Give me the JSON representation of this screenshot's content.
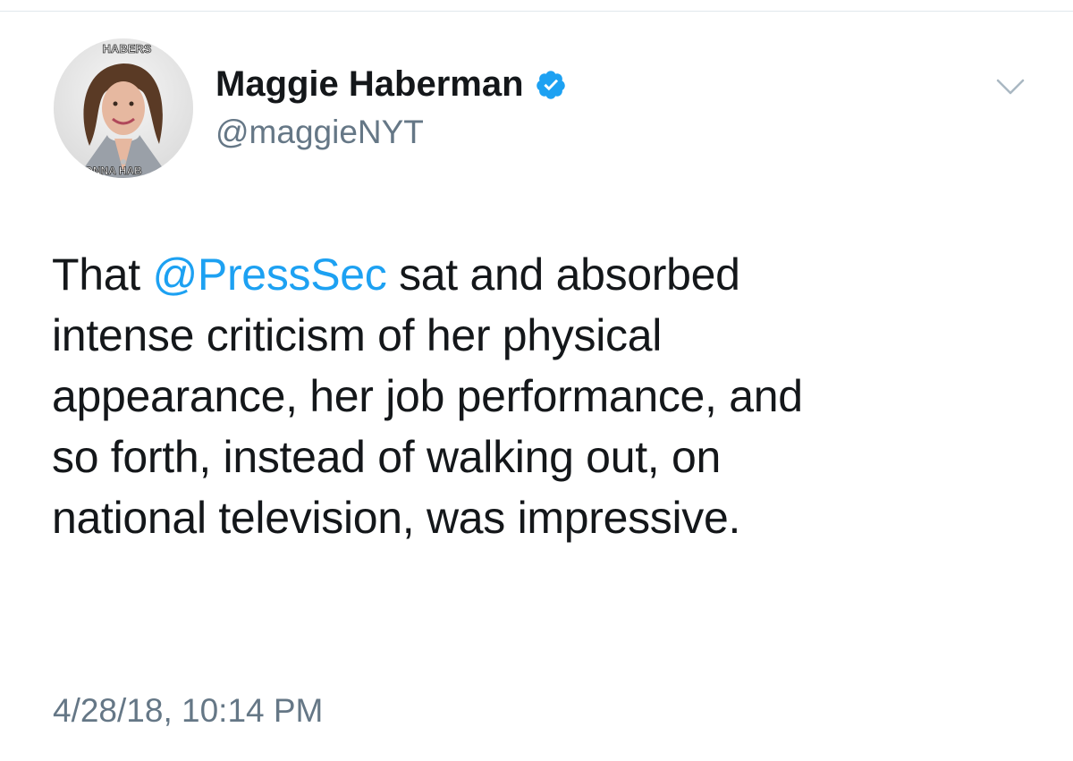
{
  "author": {
    "display_name": "Maggie Haberman",
    "handle": "@maggieNYT",
    "verified": true,
    "avatar_caption_top": "HABERS",
    "avatar_caption_bottom": "GONNA HAB"
  },
  "tweet": {
    "line1_prefix": "That ",
    "mention": "@PressSec",
    "line1_suffix": " sat and absorbed",
    "line2": "intense criticism of her physical",
    "line3": "appearance, her job performance, and",
    "line4": "so forth, instead of walking out, on",
    "line5": "national television, was impressive.",
    "timestamp": "4/28/18, 10:14 PM"
  },
  "icons": {
    "verified": "verified-badge-icon",
    "menu": "chevron-down-icon"
  },
  "colors": {
    "link": "#1da1f2",
    "text": "#14171a",
    "secondary": "#657786",
    "verified": "#1da1f2"
  }
}
